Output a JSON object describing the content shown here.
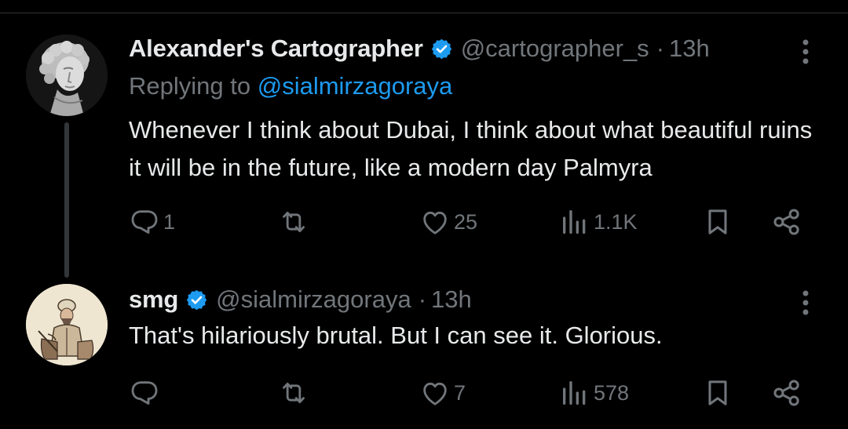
{
  "tweets": [
    {
      "display_name": "Alexander's Cartographer",
      "handle": "@cartographer_s",
      "separator": "·",
      "time": "13h",
      "verified": true,
      "avatar": "marble-bust-avatar",
      "replying_prefix": "Replying to",
      "replying_to": "@sialmirzagoraya",
      "text": "Whenever I think about Dubai, I think about what beautiful ruins it will be in the future, like a modern day Palmyra",
      "stats": {
        "replies": "1",
        "retweets": "",
        "likes": "25",
        "views": "1.1K"
      }
    },
    {
      "display_name": "smg",
      "handle": "@sialmirzagoraya",
      "separator": "·",
      "time": "13h",
      "verified": true,
      "avatar": "seated-figure-portrait-avatar",
      "text": "That's hilariously brutal. But I can see it. Glorious.",
      "stats": {
        "replies": "",
        "retweets": "",
        "likes": "7",
        "views": "578"
      }
    }
  ],
  "icons": {
    "verified": "verified-badge-icon",
    "more": "more-vertical-icon",
    "reply": "reply-icon",
    "retweet": "retweet-icon",
    "like": "heart-icon",
    "views": "views-icon",
    "bookmark": "bookmark-icon",
    "share": "share-icon"
  },
  "colors": {
    "background": "#000000",
    "text_primary": "#e7e9ea",
    "text_secondary": "#71767b",
    "accent": "#1d9bf0",
    "thread_line": "#333639",
    "divider": "#2f3336"
  }
}
